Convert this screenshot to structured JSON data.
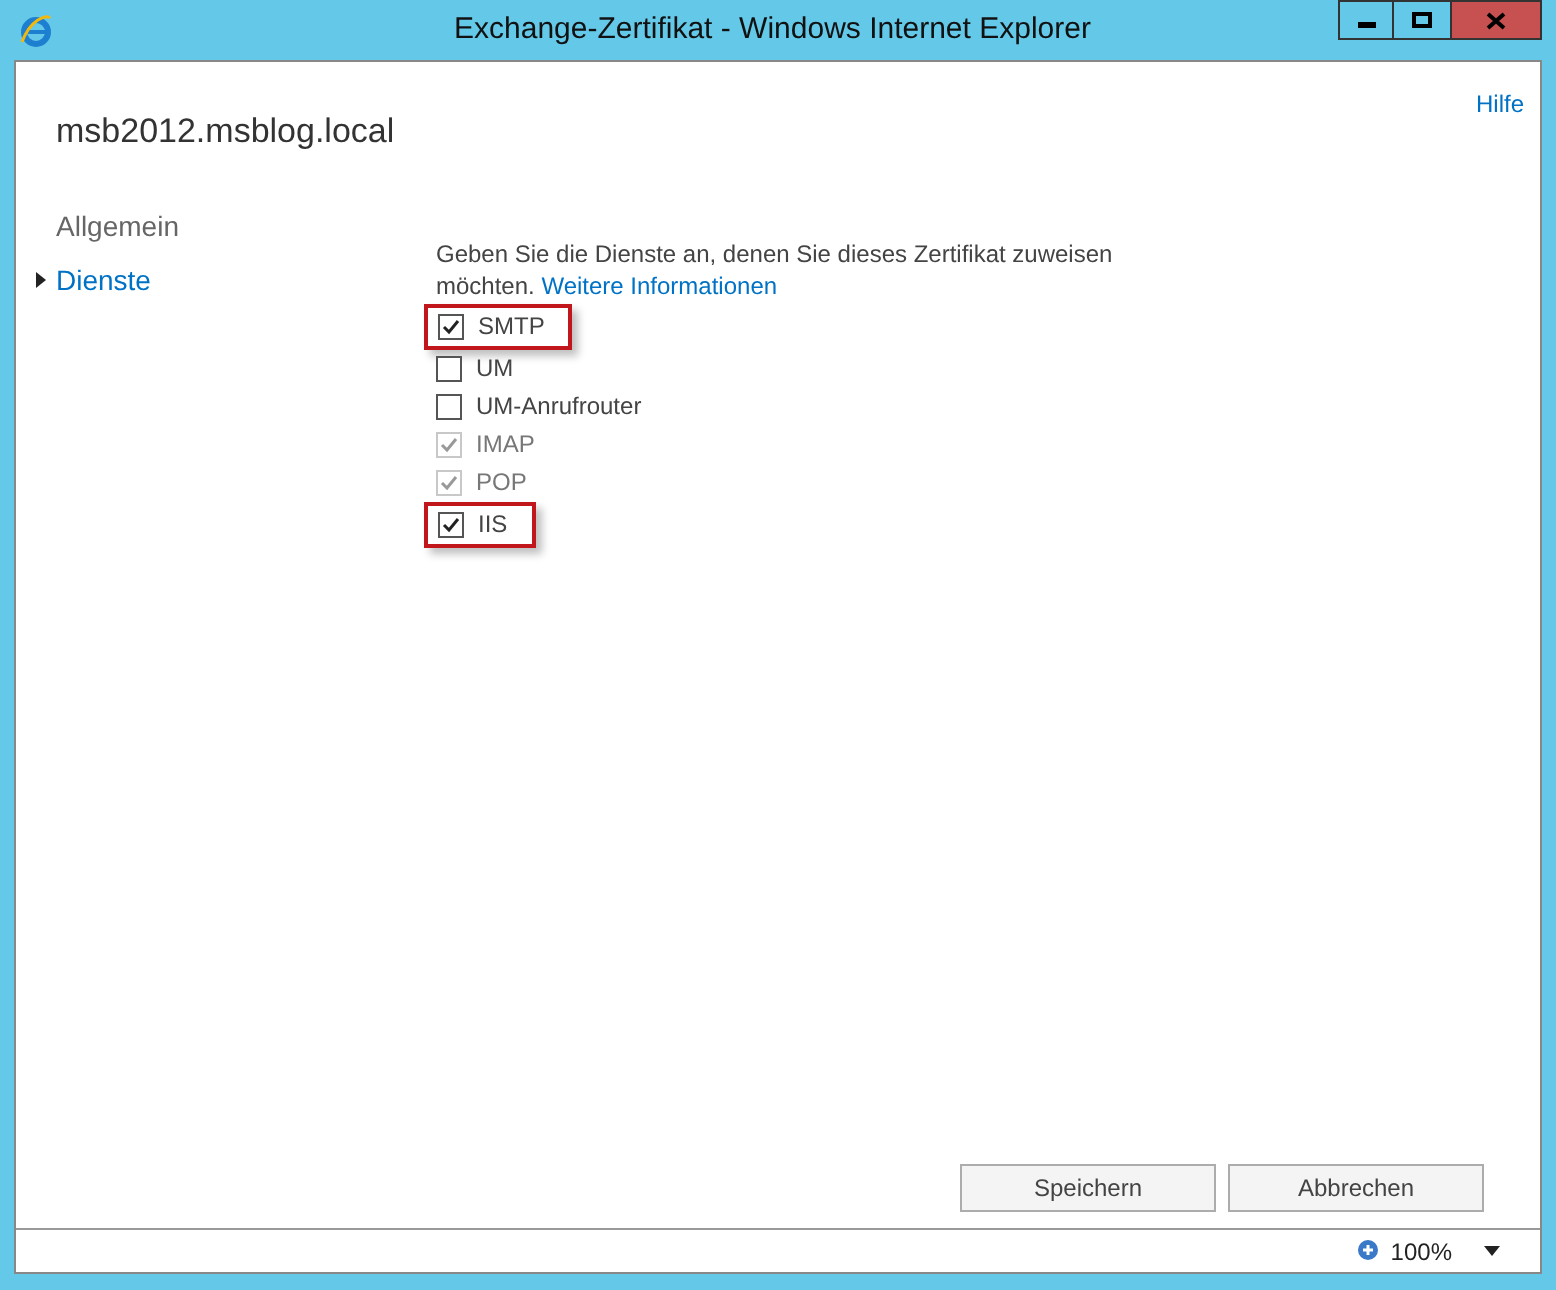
{
  "window": {
    "title": "Exchange-Zertifikat - Windows Internet Explorer"
  },
  "help_link": "Hilfe",
  "server_name": "msb2012.msblog.local",
  "nav": [
    {
      "label": "Allgemein",
      "selected": false
    },
    {
      "label": "Dienste",
      "selected": true
    }
  ],
  "intro": "Geben Sie die Dienste an, denen Sie dieses Zertifikat zuweisen möchten.",
  "more_info_link": "Weitere Informationen",
  "services": [
    {
      "label": "SMTP",
      "checked": true,
      "disabled": false,
      "highlighted": true
    },
    {
      "label": "UM",
      "checked": false,
      "disabled": false,
      "highlighted": false
    },
    {
      "label": "UM-Anrufrouter",
      "checked": false,
      "disabled": false,
      "highlighted": false
    },
    {
      "label": "IMAP",
      "checked": true,
      "disabled": true,
      "highlighted": false
    },
    {
      "label": "POP",
      "checked": true,
      "disabled": true,
      "highlighted": false
    },
    {
      "label": "IIS",
      "checked": true,
      "disabled": false,
      "highlighted": true
    }
  ],
  "buttons": [
    "Speichern",
    "Abbrechen"
  ],
  "status_bar": {
    "zoom": "100%"
  }
}
